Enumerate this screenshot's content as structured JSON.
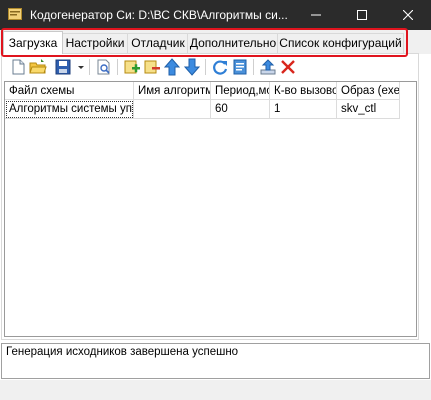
{
  "window": {
    "title": "Кодогенератор Си: D:\\ВС СКВ\\Алгоритмы си...",
    "controls": {
      "minimize": "—",
      "maximize": "☐",
      "close": "✕"
    }
  },
  "tabs": [
    {
      "label": "Загрузка",
      "active": true
    },
    {
      "label": "Настройки",
      "active": false
    },
    {
      "label": "Отладчик",
      "active": false
    },
    {
      "label": "Дополнительно",
      "active": false
    },
    {
      "label": "Список конфигураций",
      "active": false
    }
  ],
  "toolbar": {
    "buttons": [
      "new-file-icon",
      "open-folder-icon",
      "save-icon",
      "save-dropdown-chevron-icon",
      "search-icon",
      "add-row-icon",
      "remove-row-icon",
      "move-up-icon",
      "move-down-icon",
      "refresh-icon",
      "document-icon",
      "export-icon",
      "delete-icon"
    ]
  },
  "table": {
    "columns": [
      "Файл схемы",
      "Имя алгоритма",
      "Период,мс",
      "К-во вызовов",
      "Образ (exe)"
    ],
    "rows": [
      [
        "Алгоритмы системы уп",
        "",
        "60",
        "1",
        "skv_ctl"
      ]
    ]
  },
  "log": {
    "message": "Генерация исходников завершена успешно"
  },
  "colors": {
    "titlebar": "#2b2b2b",
    "highlight": "#e0141e",
    "tab_bg": "#f0f0f0",
    "active_tab_bg": "#ffffff"
  }
}
